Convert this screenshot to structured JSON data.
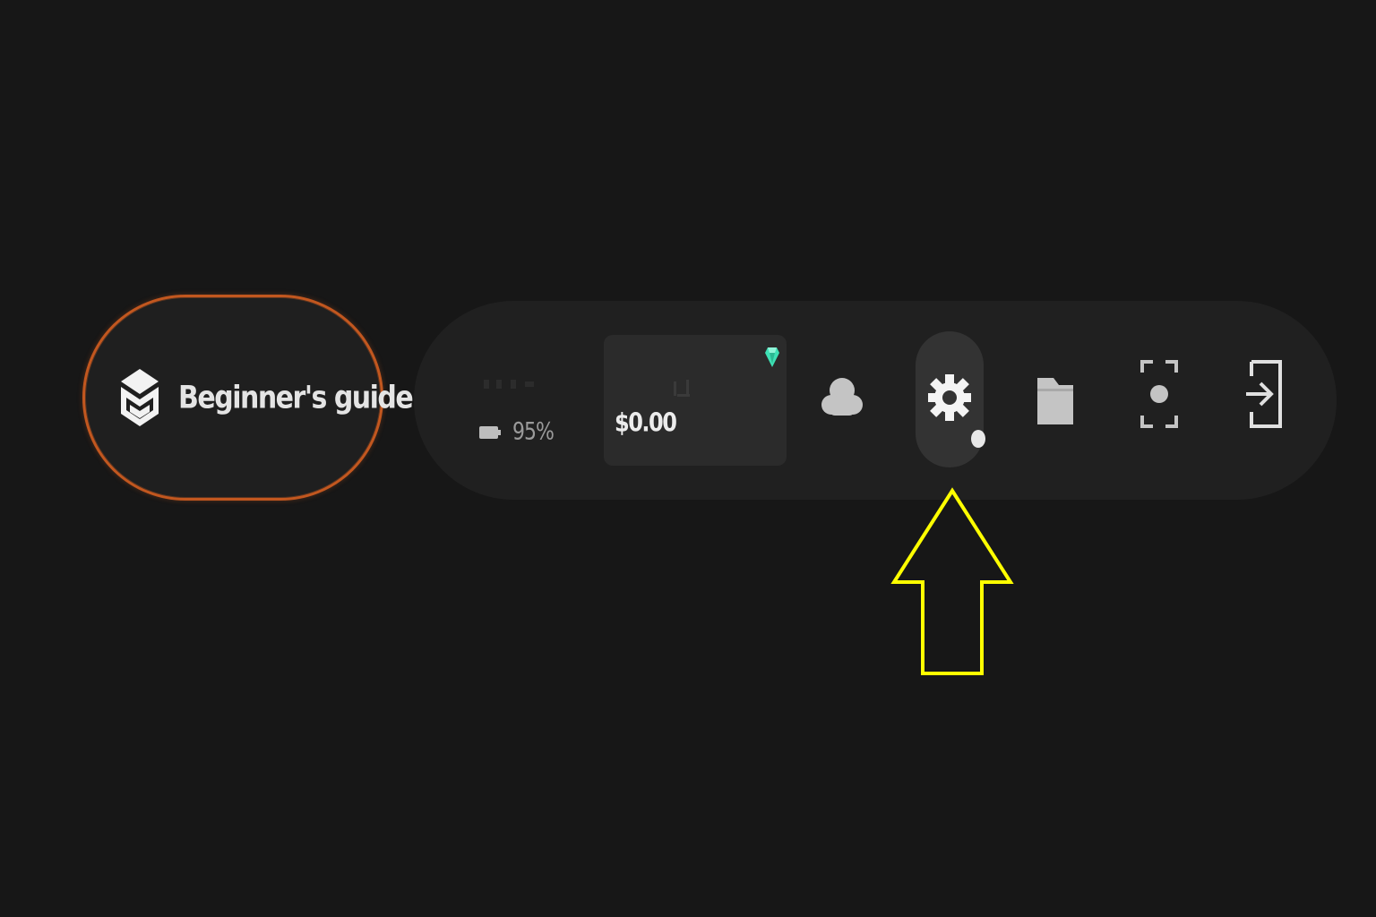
{
  "guide": {
    "label": "Beginner's guide",
    "icon": "graduation-cap-icon",
    "border_color": "#c2571f"
  },
  "status": {
    "battery_percent": "95%",
    "battery_icon": "battery-icon"
  },
  "wallet": {
    "balance": "$0.00",
    "badge_icon": "gem-icon",
    "badge_color": "#3ee0b4"
  },
  "toolbar": {
    "items": [
      {
        "name": "cloud",
        "icon": "cloud-icon"
      },
      {
        "name": "settings",
        "icon": "gear-icon",
        "active": true
      },
      {
        "name": "files",
        "icon": "folder-icon"
      },
      {
        "name": "screen-capture",
        "icon": "scan-focus-icon"
      },
      {
        "name": "sign-in",
        "icon": "login-icon"
      }
    ]
  },
  "annotation": {
    "type": "up-arrow",
    "color": "#ffff00",
    "points_to": "settings"
  }
}
